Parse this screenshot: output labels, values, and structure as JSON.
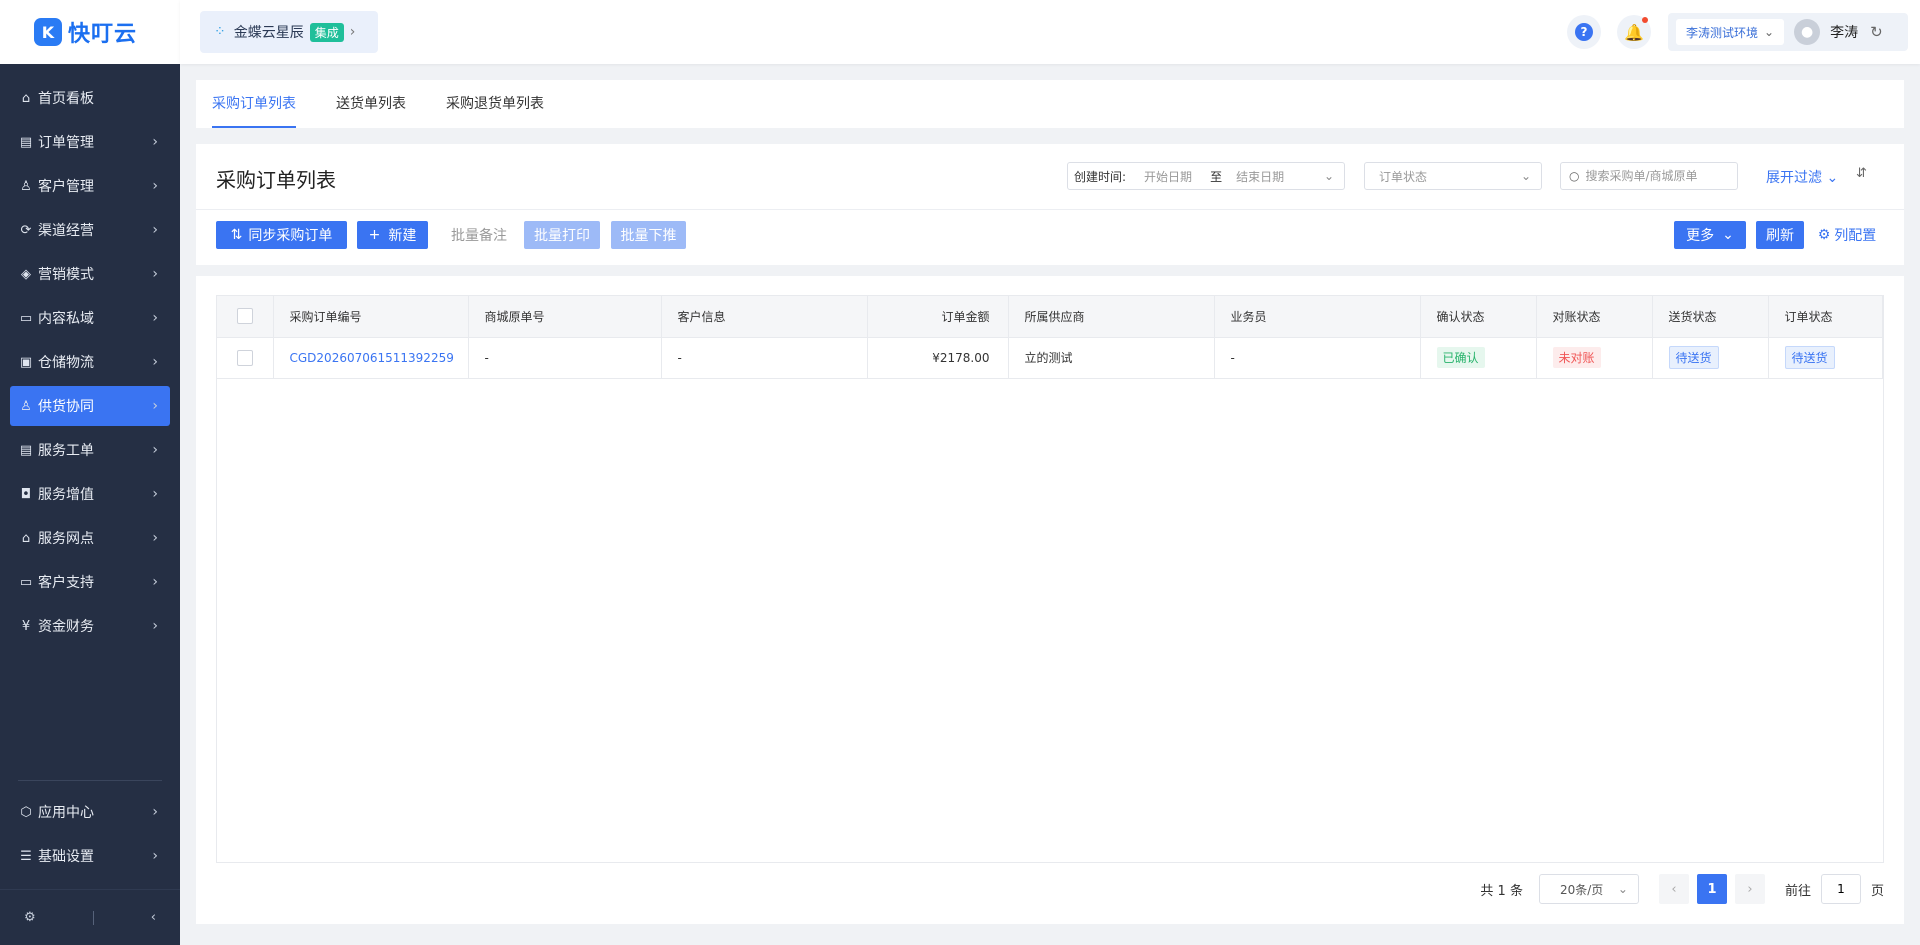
{
  "brand": {
    "logo_mark": "K",
    "logo_text": "快叮云"
  },
  "header": {
    "integration_name": "金蝶云星辰",
    "integration_tag": "集成",
    "env": "李涛测试环境",
    "user_name": "李涛"
  },
  "sidebar": {
    "items": [
      {
        "label": "首页看板",
        "icon": "home-icon"
      },
      {
        "label": "订单管理",
        "icon": "order-icon"
      },
      {
        "label": "客户管理",
        "icon": "user-icon"
      },
      {
        "label": "渠道经营",
        "icon": "channel-icon"
      },
      {
        "label": "营销模式",
        "icon": "tag-icon"
      },
      {
        "label": "内容私域",
        "icon": "image-icon"
      },
      {
        "label": "仓储物流",
        "icon": "warehouse-icon"
      },
      {
        "label": "供货协同",
        "icon": "supply-icon"
      },
      {
        "label": "服务工单",
        "icon": "ticket-icon"
      },
      {
        "label": "服务增值",
        "icon": "bag-icon"
      },
      {
        "label": "服务网点",
        "icon": "store-icon"
      },
      {
        "label": "客户支持",
        "icon": "support-icon"
      },
      {
        "label": "资金财务",
        "icon": "yuan-icon"
      }
    ],
    "bottom_items": [
      {
        "label": "应用中心",
        "icon": "app-icon"
      },
      {
        "label": "基础设置",
        "icon": "settings-icon"
      }
    ]
  },
  "tabs": [
    "采购订单列表",
    "送货单列表",
    "采购退货单列表"
  ],
  "toolbar": {
    "title": "采购订单列表",
    "date_label": "创建时间:",
    "start_placeholder": "开始日期",
    "to": "至",
    "end_placeholder": "结束日期",
    "status_placeholder": "订单状态",
    "search_placeholder": "搜索采购单/商城原单",
    "expand_filter": "展开过滤",
    "sync_btn": "同步采购订单",
    "new_btn": "新建",
    "batch_note": "批量备注",
    "batch_print": "批量打印",
    "batch_push": "批量下推",
    "more": "更多",
    "refresh": "刷新",
    "columns": "列配置"
  },
  "table": {
    "headers": [
      "采购订单编号",
      "商城原单号",
      "客户信息",
      "订单金额",
      "所属供应商",
      "业务员",
      "确认状态",
      "对账状态",
      "送货状态",
      "订单状态"
    ],
    "rows": [
      {
        "order_no": "CGD202607061511392259",
        "mall_no": "-",
        "customer": "-",
        "amount": "¥2178.00",
        "supplier": "立的测试",
        "salesman": "-",
        "confirm": "已确认",
        "reconcile": "未对账",
        "delivery": "待送货",
        "status": "待送货"
      }
    ]
  },
  "pagination": {
    "total": "共 1 条",
    "page_size": "20条/页",
    "current": "1",
    "goto_label": "前往",
    "goto_value": "1",
    "page_unit": "页"
  }
}
